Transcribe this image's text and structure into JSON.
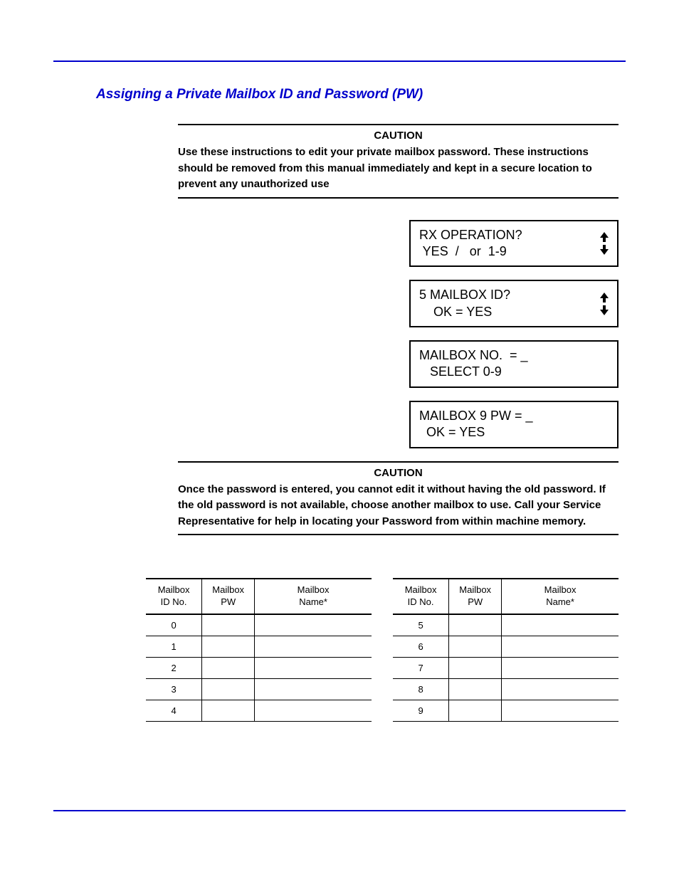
{
  "title": "Assigning a Private Mailbox ID and Password (PW)",
  "caution1": {
    "heading": "CAUTION",
    "text": "Use these instructions to edit your private mailbox password. These instructions should be removed from this manual immediately and kept in a secure location to prevent any unauthorized use"
  },
  "displays": [
    {
      "line1": "RX OPERATION?",
      "line2": " YES  /   or  1-9",
      "arrows": true
    },
    {
      "line1": "5 MAILBOX ID?",
      "line2": "    OK = YES",
      "arrows": true
    },
    {
      "line1": "MAILBOX NO.  = _",
      "line2": "   SELECT 0-9",
      "arrows": false
    },
    {
      "line1": "MAILBOX 9 PW = _",
      "line2": "  OK = YES",
      "arrows": false
    }
  ],
  "caution2": {
    "heading": "CAUTION",
    "text": "Once the password is entered, you cannot edit it without having the old password. If the old password is not available, choose another mailbox to use. Call your Service Representative for help in locating your Password from within machine memory."
  },
  "table_headers": {
    "col1a": "Mailbox",
    "col1b": "ID No.",
    "col2a": "Mailbox",
    "col2b": "PW",
    "col3a": "Mailbox",
    "col3b": "Name*"
  },
  "table_left": [
    "0",
    "1",
    "2",
    "3",
    "4"
  ],
  "table_right": [
    "5",
    "6",
    "7",
    "8",
    "9"
  ]
}
